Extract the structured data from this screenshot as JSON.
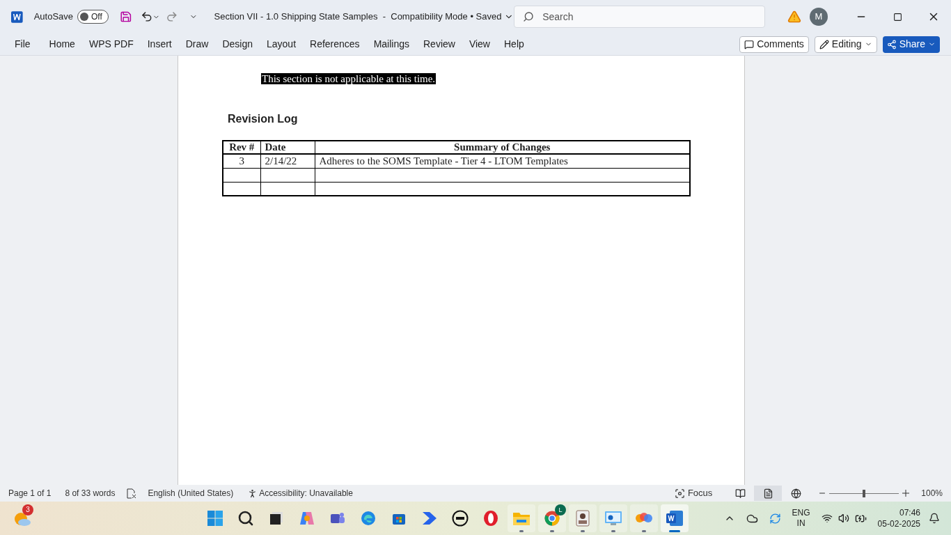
{
  "title_bar": {
    "autosave_label": "AutoSave",
    "autosave": {
      "on": false,
      "label": "Off"
    },
    "document_title": "Section VII - 1.0 Shipping State Samples  -  Compatibility Mode • Saved",
    "search": {
      "placeholder": "Search"
    },
    "avatar": "M"
  },
  "ribbon_tabs": [
    {
      "label": "File",
      "selected": false
    },
    {
      "label": "Home",
      "selected": false
    },
    {
      "label": "WPS PDF",
      "selected": false
    },
    {
      "label": "Insert",
      "selected": false
    },
    {
      "label": "Draw",
      "selected": false
    },
    {
      "label": "Design",
      "selected": false
    },
    {
      "label": "Layout",
      "selected": false
    },
    {
      "label": "References",
      "selected": false
    },
    {
      "label": "Mailings",
      "selected": false
    },
    {
      "label": "Review",
      "selected": false
    },
    {
      "label": "View",
      "selected": false
    },
    {
      "label": "Help",
      "selected": false
    }
  ],
  "ribbon_buttons": {
    "comments": "Comments",
    "editing": "Editing",
    "share": "Share"
  },
  "document": {
    "selected_text": "This section is not applicable at this time.",
    "heading": "Revision Log",
    "table": {
      "columns": [
        "Rev #",
        "Date",
        "Summary of Changes"
      ],
      "rows": [
        [
          "3",
          "2/14/22",
          "Adheres to the SOMS Template - Tier 4 - LTOM Templates"
        ],
        [
          "",
          "",
          ""
        ],
        [
          "",
          "",
          ""
        ]
      ]
    }
  },
  "status_bar": {
    "page": "Page 1 of 1",
    "words": "8 of 33 words",
    "language": "English (United States)",
    "accessibility": "Accessibility: Unavailable",
    "focus": "Focus",
    "views": [
      {
        "kind": "read",
        "selected": false
      },
      {
        "kind": "print",
        "selected": true
      },
      {
        "kind": "web",
        "selected": false
      }
    ],
    "zoom": {
      "level": 0.5,
      "reading": "100%"
    }
  },
  "taskbar": {
    "weather_badge": "3",
    "apps": [
      {
        "kind": "start",
        "running": false,
        "selected": false
      },
      {
        "kind": "search",
        "running": false,
        "selected": false
      },
      {
        "kind": "taskview",
        "running": false,
        "selected": false
      },
      {
        "kind": "copilot",
        "running": false,
        "selected": false
      },
      {
        "kind": "teams",
        "running": false,
        "selected": false
      },
      {
        "kind": "edge",
        "running": false,
        "selected": false
      },
      {
        "kind": "store",
        "running": false,
        "selected": false
      },
      {
        "kind": "automate",
        "running": false,
        "selected": false
      },
      {
        "kind": "dell",
        "running": false,
        "selected": false
      },
      {
        "kind": "opera",
        "running": false,
        "selected": false
      },
      {
        "kind": "explorer",
        "running": true,
        "selected": false
      },
      {
        "kind": "chrome",
        "running": true,
        "selected": false,
        "badge": "L"
      },
      {
        "kind": "idcard",
        "running": true,
        "selected": false
      },
      {
        "kind": "monitor",
        "running": true,
        "selected": false
      },
      {
        "kind": "blobs",
        "running": true,
        "selected": false
      },
      {
        "kind": "word",
        "running": true,
        "selected": true
      }
    ],
    "language": "ENG",
    "region": "IN",
    "time": "07:46",
    "date": "05-02-2025"
  }
}
